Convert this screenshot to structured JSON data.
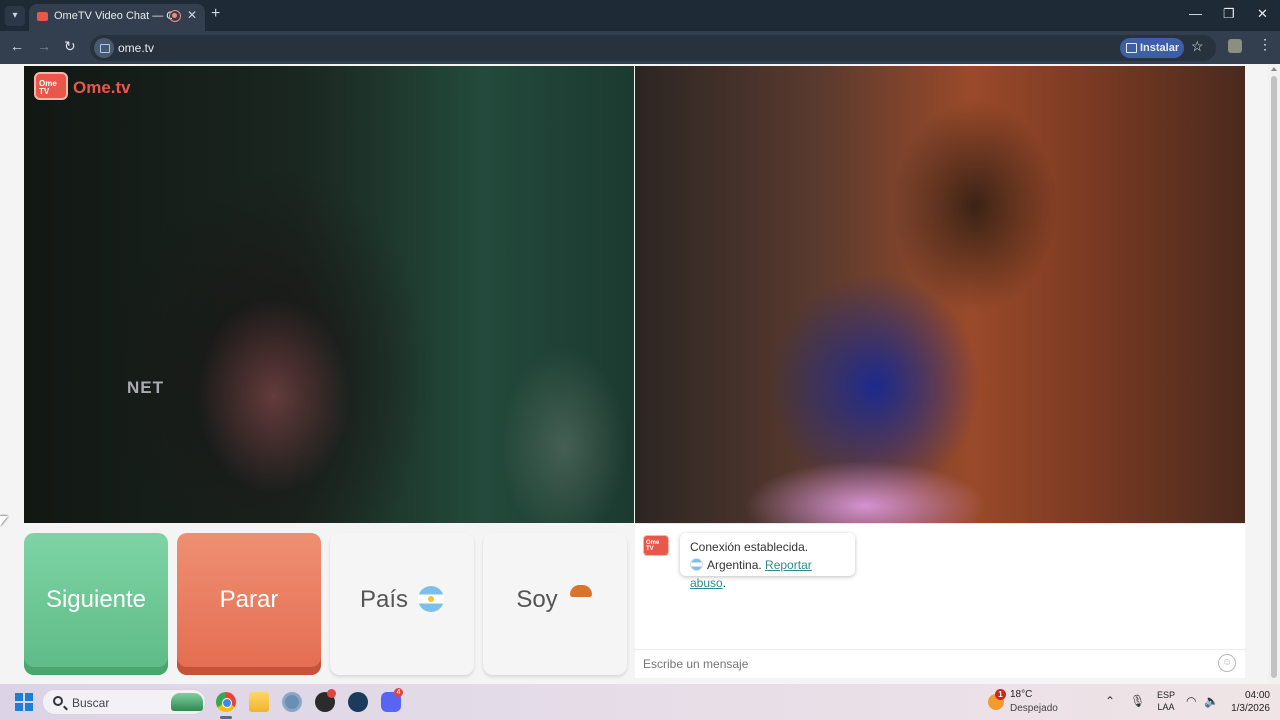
{
  "browser": {
    "tab_title": "OmeTV Video Chat — Omegle",
    "tab_list_icon": "chevron-down-icon",
    "new_tab_icon": "+",
    "url": "ome.tv",
    "install_label": "Instalar",
    "window_minimize": "—",
    "window_restore": "❐",
    "window_close": "✕"
  },
  "page": {
    "logo_text": "Ome.tv",
    "logo_tv": "Ome TV",
    "left_cam_overlay_text": "NET",
    "buttons": {
      "next": "Siguiente",
      "stop": "Parar",
      "country": "País",
      "gender": "Soy"
    },
    "chat": {
      "status": "Conexión establecida.",
      "country": "Argentina.",
      "report": "Reportar abuso",
      "report_suffix": ".",
      "input_placeholder": "Escribe un mensaje"
    }
  },
  "taskbar": {
    "search_placeholder": "Buscar",
    "weather_badge": "1",
    "weather_temp": "18°C",
    "weather_desc": "Despejado",
    "lang_top": "ESP",
    "lang_bottom": "LAA",
    "time": "04:00",
    "date": "1/3/2026",
    "discord_badge": "4"
  },
  "colors": {
    "next": "#6cc794",
    "stop": "#e87a5d",
    "accent": "#2e8b8b"
  }
}
